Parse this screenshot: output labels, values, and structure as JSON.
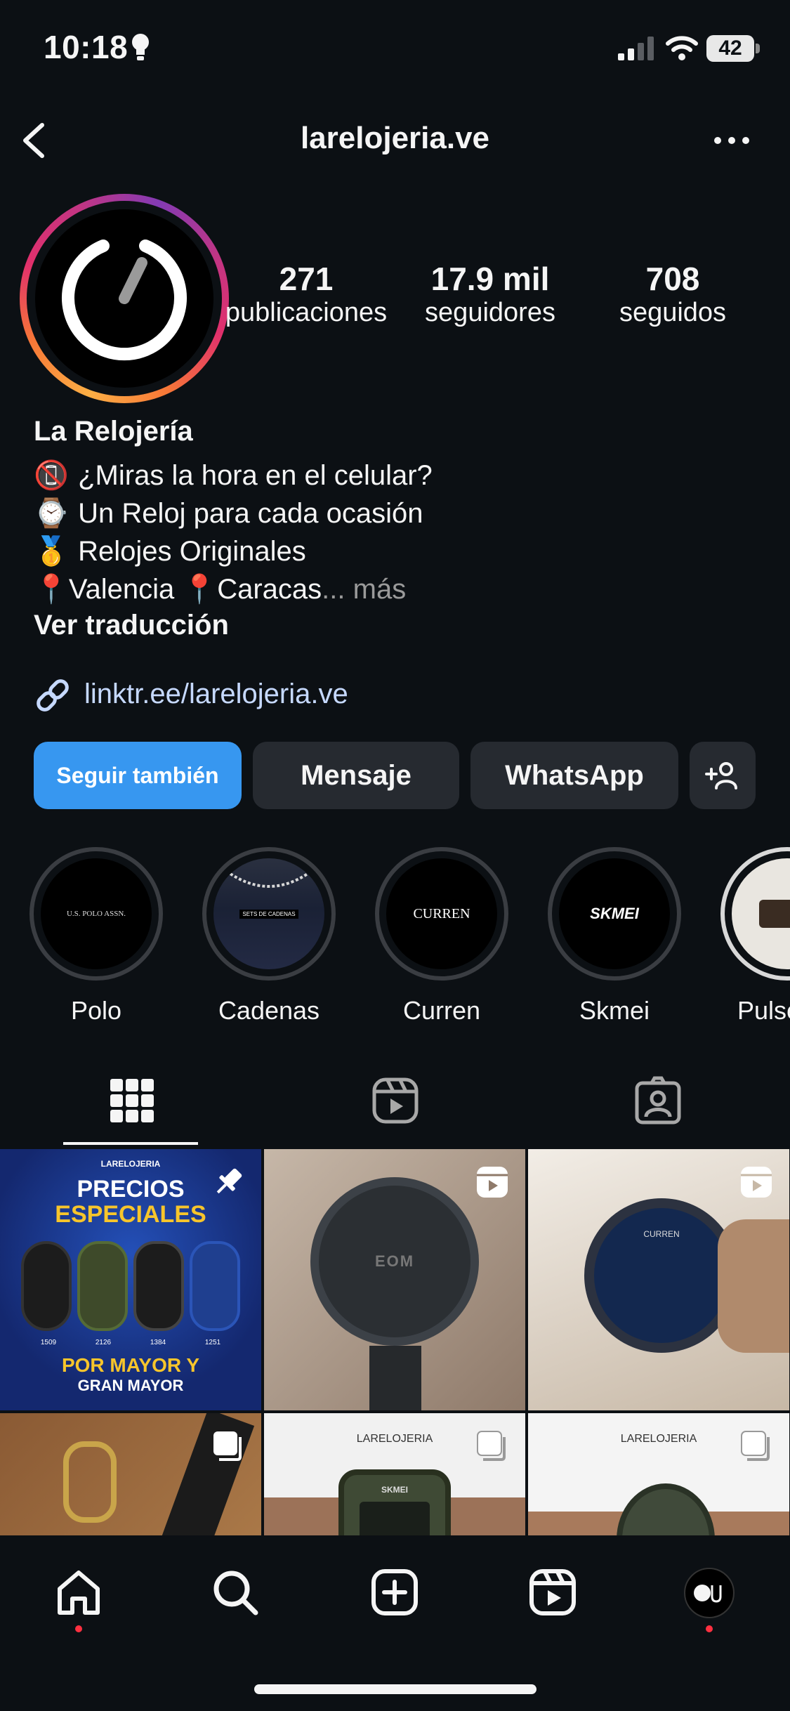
{
  "status_bar": {
    "time": "10:18",
    "battery": "42"
  },
  "header": {
    "username": "larelojeria.ve"
  },
  "stats": [
    {
      "num": "271",
      "label": "publicaciones"
    },
    {
      "num": "17.9 mil",
      "label": "seguidores"
    },
    {
      "num": "708",
      "label": "seguidos"
    }
  ],
  "bio": {
    "name": "La Relojería",
    "lines": [
      {
        "emoji": "📵",
        "text": "¿Miras la hora en el celular?"
      },
      {
        "emoji": "⌚",
        "text": "Un Reloj para cada ocasión"
      },
      {
        "emoji": "🥇",
        "text": "Relojes Originales"
      }
    ],
    "location_a_emoji": "📍",
    "location_a": "Valencia",
    "location_b_emoji": "📍",
    "location_b": "Caracas",
    "more": "... más",
    "translate": "Ver traducción",
    "link": "linktr.ee/larelojeria.ve"
  },
  "buttons": {
    "follow": "Seguir también",
    "message": "Mensaje",
    "whatsapp": "WhatsApp"
  },
  "highlights": [
    {
      "label": "Polo",
      "brand": "U.S. POLO ASSN."
    },
    {
      "label": "Cadenas",
      "brand": "SETS DE CADENAS"
    },
    {
      "label": "Curren",
      "brand": "CURREN"
    },
    {
      "label": "Skmei",
      "brand": "SKMEI"
    },
    {
      "label": "Pulse",
      "brand": ""
    }
  ],
  "posts": [
    {
      "logo": "LARELOJERIA",
      "title1": "PRECIOS",
      "title2": "ESPECIALES",
      "footer1": "POR MAYOR Y",
      "footer2": "GRAN MAYOR",
      "codes": [
        "1509",
        "2126",
        "1384",
        "1251"
      ]
    },
    {
      "brand": "EOM"
    },
    {
      "brand": "CURREN"
    },
    {
      "brand": ""
    },
    {
      "logo": "LARELOJERIA",
      "brand": "SKMEI"
    },
    {
      "logo": "LARELOJERIA"
    }
  ],
  "colors": {
    "background": "#0c1014",
    "follow_button": "#3797f0",
    "link": "#c6d9ff",
    "notification_dot": "#ff3040"
  }
}
